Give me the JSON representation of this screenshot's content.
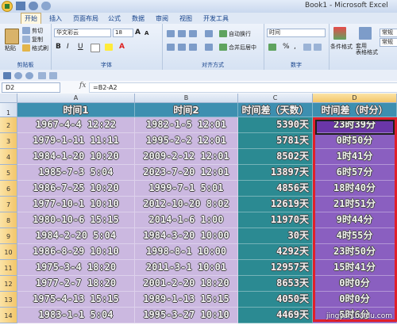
{
  "window": {
    "title": "Book1 - Microsoft Excel"
  },
  "ribbon_tabs": [
    {
      "label": "开始",
      "active": true
    },
    {
      "label": "插入",
      "active": false
    },
    {
      "label": "页面布局",
      "active": false
    },
    {
      "label": "公式",
      "active": false
    },
    {
      "label": "数据",
      "active": false
    },
    {
      "label": "审阅",
      "active": false
    },
    {
      "label": "视图",
      "active": false
    },
    {
      "label": "开发工具",
      "active": false
    }
  ],
  "clipboard": {
    "paste": "粘贴",
    "cut": "剪切",
    "copy": "复制",
    "painter": "格式刷",
    "caption": "剪贴板"
  },
  "font": {
    "name": "华文彩云",
    "size": "18",
    "bold": "B",
    "italic": "I",
    "underline": "U",
    "grow": "A",
    "shrink": "A",
    "color_letter": "A",
    "caption": "字体"
  },
  "alignment": {
    "wrap": "自动换行",
    "merge": "合并后居中",
    "caption": "对齐方式"
  },
  "number": {
    "format": "时间",
    "percent": "%",
    "comma": ",",
    "caption": "数字"
  },
  "styles": {
    "conditional": "条件格式",
    "table": "套用\n表格格式",
    "normal1": "常规",
    "normal2": "常规"
  },
  "formula_bar": {
    "cell_ref": "D2",
    "fx": "fx",
    "formula": "=B2-A2"
  },
  "columns": [
    "A",
    "B",
    "C",
    "D"
  ],
  "rows": [
    "1",
    "2",
    "3",
    "4",
    "5",
    "6",
    "7",
    "8",
    "9",
    "10",
    "11",
    "12",
    "13",
    "14"
  ],
  "headers": [
    "时间1",
    "时间2",
    "时间差（天数）",
    "时间差（时分）"
  ],
  "table": [
    [
      "1967-4-4 12:22",
      "1982-1-5 12:01",
      "5390天",
      "23时39分"
    ],
    [
      "1979-1-11 11:11",
      "1995-2-2 12:01",
      "5781天",
      "0时50分"
    ],
    [
      "1984-1-20 10:20",
      "2009-2-12 12:01",
      "8502天",
      "1时41分"
    ],
    [
      "1985-7-3 5:04",
      "2023-7-20 12:01",
      "13897天",
      "6时57分"
    ],
    [
      "1986-7-25 10:20",
      "1999-7-1 5:01",
      "4856天",
      "18时40分"
    ],
    [
      "1977-10-1 10:10",
      "2012-10-20 8:02",
      "12619天",
      "21时51分"
    ],
    [
      "1980-10-6 15:15",
      "2014-1-6 1:00",
      "11970天",
      "9时44分"
    ],
    [
      "1984-2-20 5:04",
      "1984-3-20 10:00",
      "30天",
      "4时55分"
    ],
    [
      "1986-8-29 10:10",
      "1998-8-1 10:00",
      "4292天",
      "23时50分"
    ],
    [
      "1975-3-4 18:20",
      "2011-3-1 10:01",
      "12957天",
      "15时41分"
    ],
    [
      "1977-2-7 18:20",
      "2001-2-20 18:20",
      "8653天",
      "0时0分"
    ],
    [
      "1975-4-13 15:15",
      "1989-1-13 15:15",
      "4050天",
      "0时0分"
    ],
    [
      "1983-1-1 5:04",
      "1995-3-27 10:10",
      "4469天",
      "5时6分"
    ]
  ],
  "watermark": "jingyan.baidu.com",
  "colors": {
    "colA": "#cbb8e0",
    "colB": "#cbb8e0",
    "colC": "#2b8a92",
    "colD": "#8a5fc0",
    "header_row": "#3d8fb0",
    "selection": "#e0202a"
  }
}
